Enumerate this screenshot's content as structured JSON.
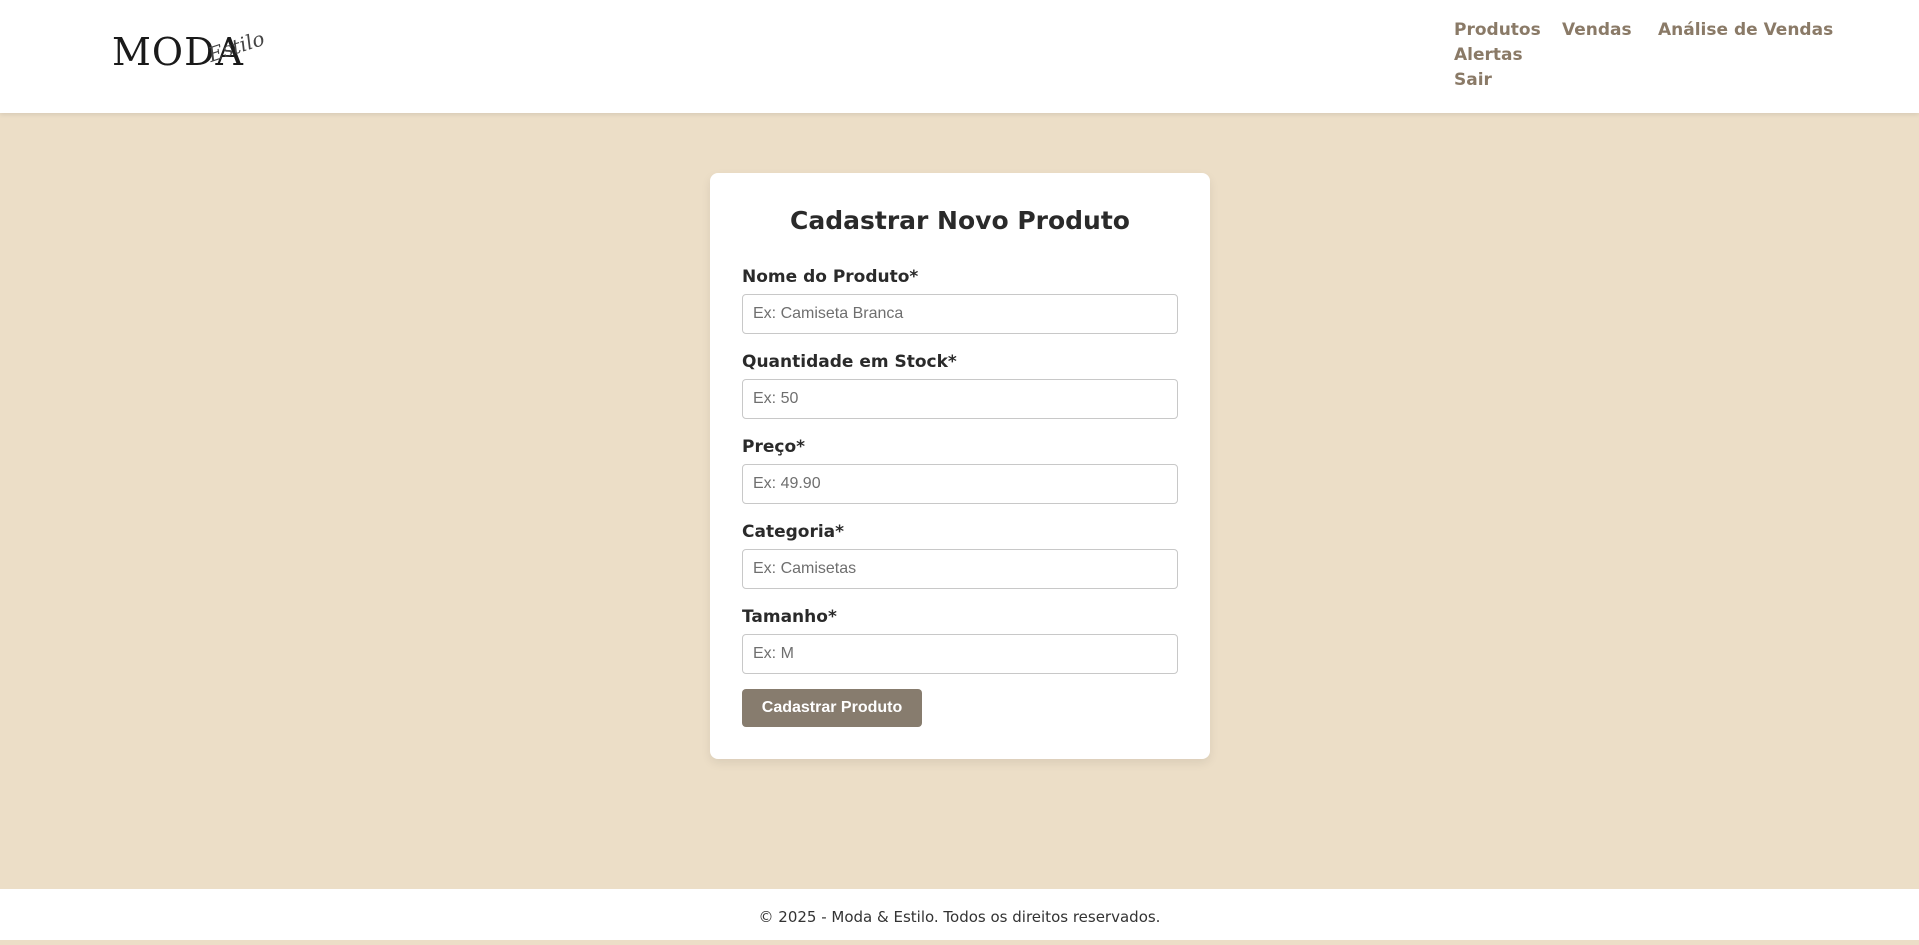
{
  "brand": {
    "logo_main": "MODA",
    "logo_script": "Estilo"
  },
  "nav": {
    "items": [
      "Produtos",
      "Vendas",
      "Análise de Vendas",
      "Alertas",
      "Sair"
    ]
  },
  "form": {
    "title": "Cadastrar Novo Produto",
    "fields": [
      {
        "label": "Nome do Produto*",
        "placeholder": "Ex: Camiseta Branca",
        "value": ""
      },
      {
        "label": "Quantidade em Stock*",
        "placeholder": "Ex: 50",
        "value": ""
      },
      {
        "label": "Preço*",
        "placeholder": "Ex: 49.90",
        "value": ""
      },
      {
        "label": "Categoria*",
        "placeholder": "Ex: Camisetas",
        "value": ""
      },
      {
        "label": "Tamanho*",
        "placeholder": "Ex: M",
        "value": ""
      }
    ],
    "submit_label": "Cadastrar Produto"
  },
  "footer": {
    "text": "© 2025 - Moda & Estilo. Todos os direitos reservados."
  },
  "colors": {
    "page_background": "#ecdec7",
    "nav_link": "#8a7a67",
    "button": "#877c6e"
  }
}
